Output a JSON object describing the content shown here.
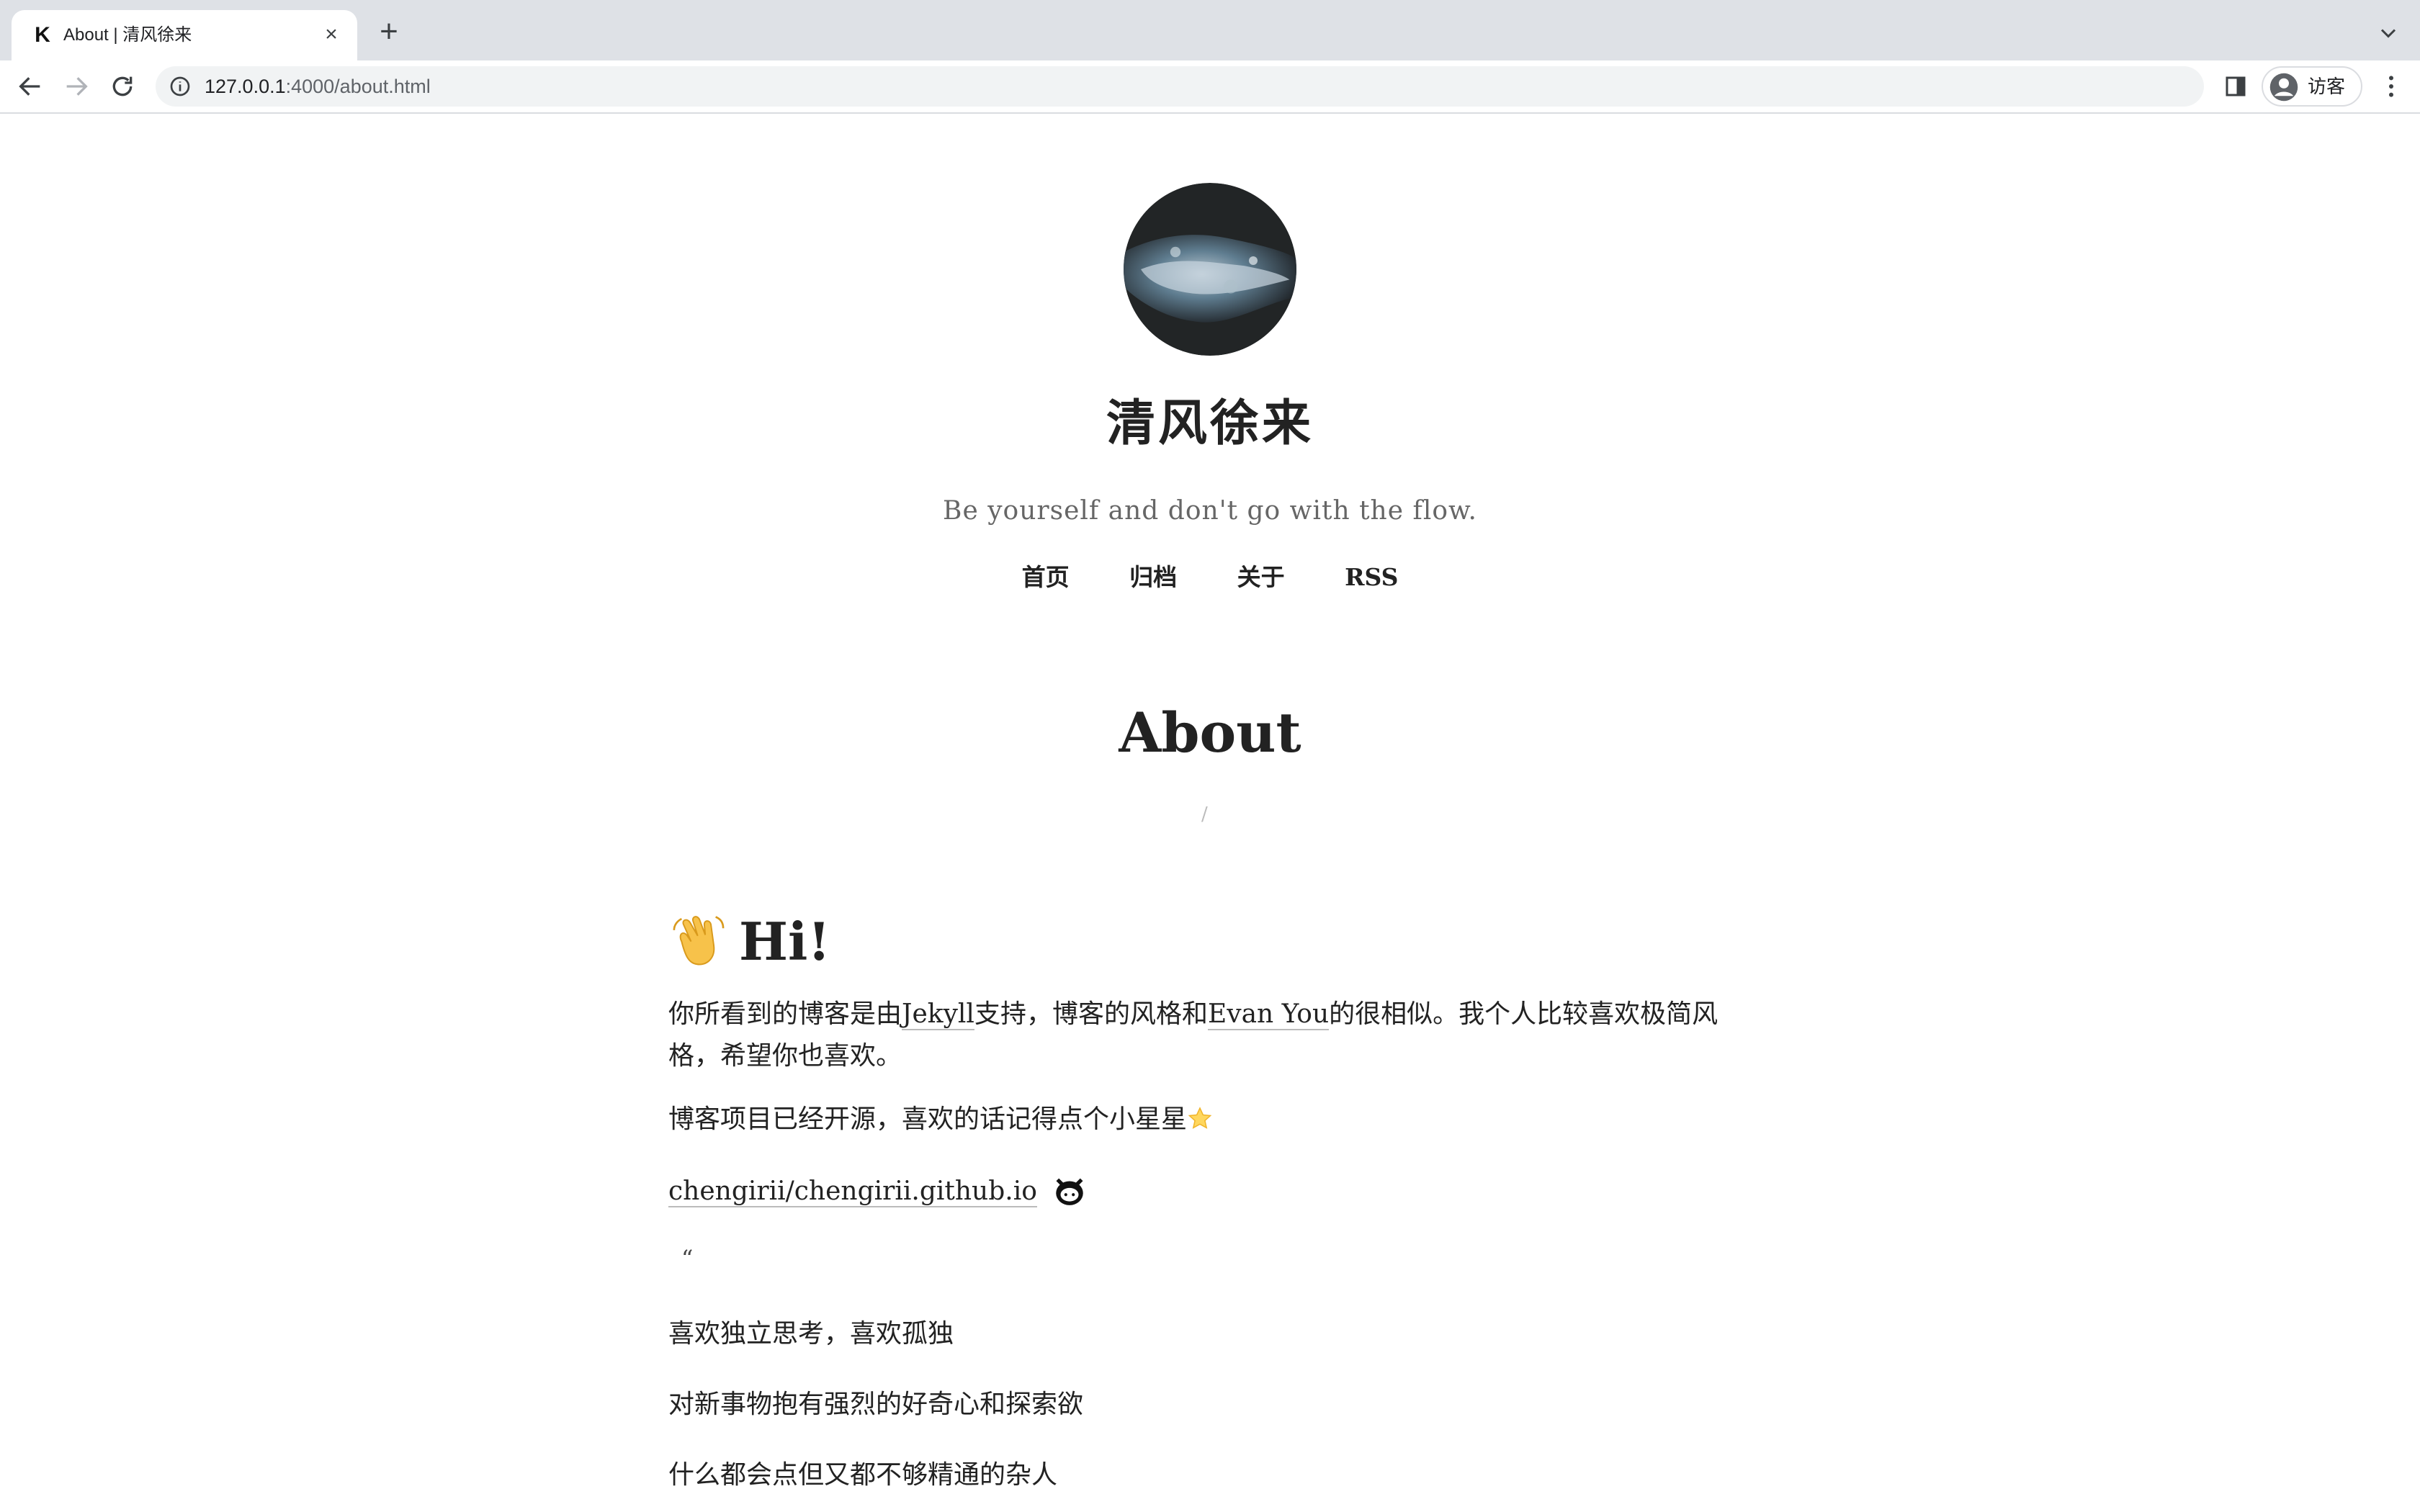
{
  "browser": {
    "tab_title": "About | 清风徐来",
    "tab_favicon": "K",
    "url_host": "127.0.0.1",
    "url_rest": ":4000/about.html",
    "profile_label": "访客"
  },
  "site": {
    "title": "清风徐来",
    "tagline": "Be yourself and don't go with the flow.",
    "nav": [
      "首页",
      "归档",
      "关于",
      "RSS"
    ]
  },
  "page": {
    "heading": "About",
    "divider": "/"
  },
  "content": {
    "hi": "Hi!",
    "intro_pre": "你所看到的博客是由",
    "intro_link1": "Jekyll",
    "intro_mid": "支持，博客的风格和",
    "intro_link2": "Evan You",
    "intro_post": "的很相似。我个人比较喜欢极简风格，希望你也喜欢。",
    "open_source": "博客项目已经开源，喜欢的话记得点个小星星",
    "repo_link": "chengirii/chengirii.github.io",
    "quote_mark": "“",
    "line1": "喜欢独立思考，喜欢孤独",
    "line2": "对新事物抱有强烈的好奇心和探索欲",
    "line3": "什么都会点但又都不够精通的杂人"
  },
  "colors": {
    "tabstrip": "#dee1e6",
    "text": "#222222",
    "muted": "#666666"
  }
}
